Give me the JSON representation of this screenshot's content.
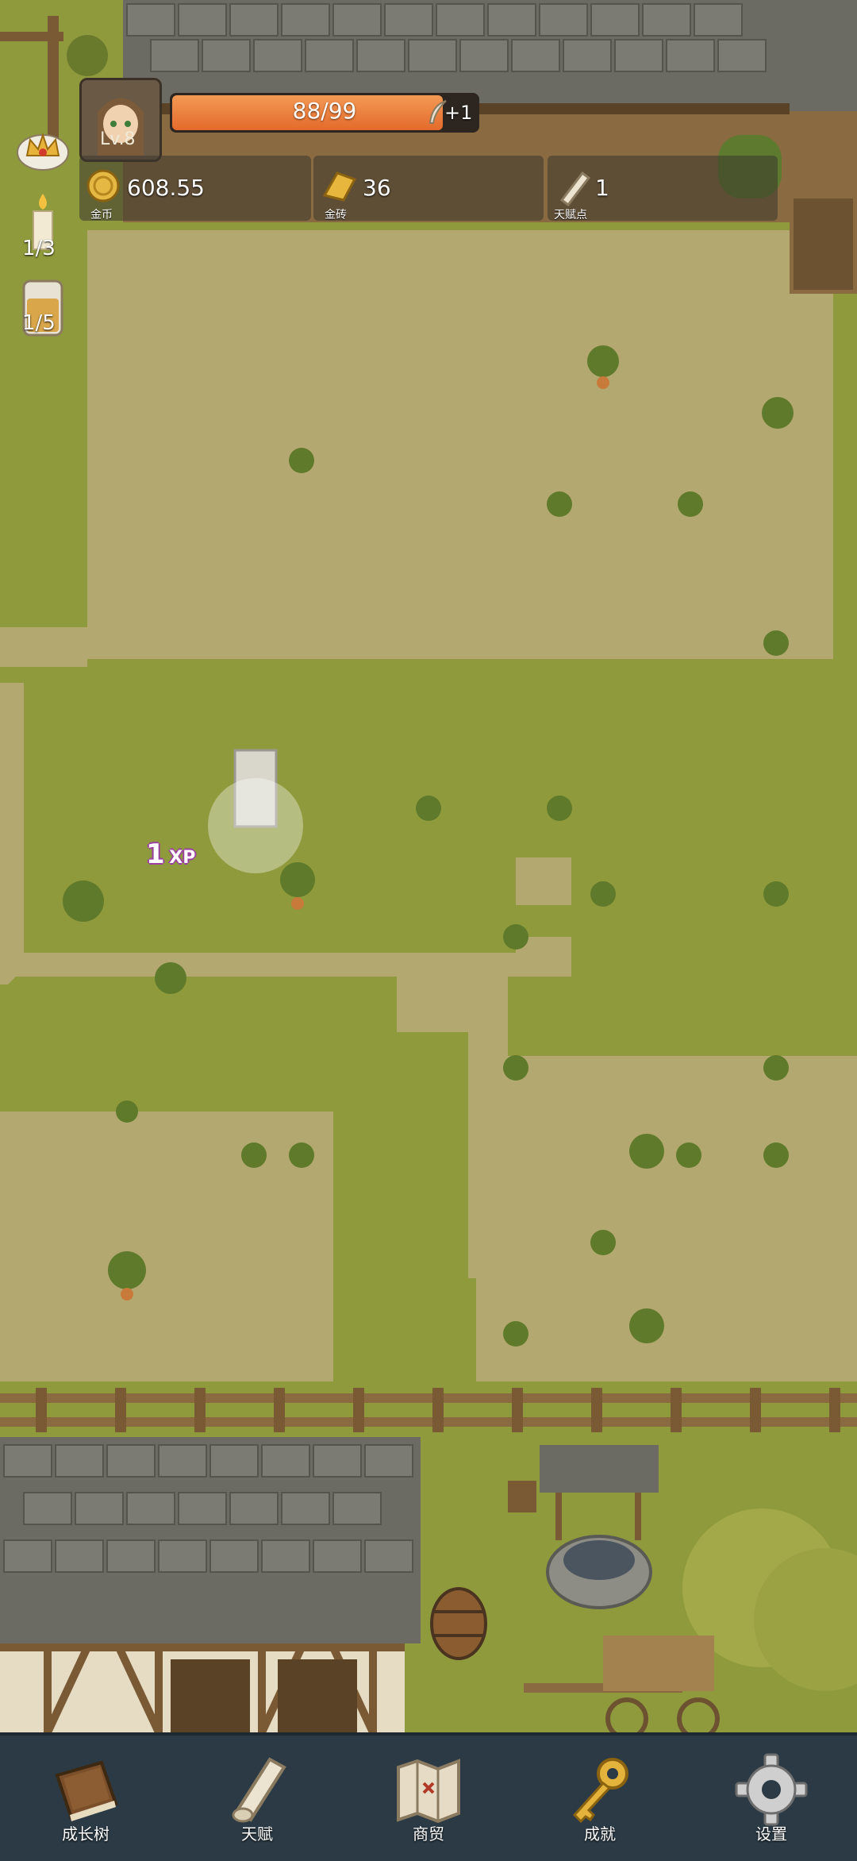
{
  "player": {
    "level": "Lv.8"
  },
  "hp": {
    "text": "88/99",
    "fraction": 0.889,
    "bonus": "+1"
  },
  "resources": [
    {
      "value": "608.55",
      "label": "金币",
      "icon": "gold-coin-icon"
    },
    {
      "value": "36",
      "label": "金砖",
      "icon": "gold-bar-icon"
    },
    {
      "value": "1",
      "label": "天赋点",
      "icon": "scroll-icon"
    }
  ],
  "side": {
    "candle": "1/3",
    "drink": "1/5"
  },
  "floating": {
    "xp_number": "1",
    "xp_unit": "XP"
  },
  "nav": [
    {
      "label": "成长树",
      "icon": "book-icon"
    },
    {
      "label": "天赋",
      "icon": "scroll-icon"
    },
    {
      "label": "商贸",
      "icon": "map-icon"
    },
    {
      "label": "成就",
      "icon": "key-icon"
    },
    {
      "label": "设置",
      "icon": "gear-icon"
    }
  ],
  "colors": {
    "grass": "#8f9a3c",
    "dirt": "#b3a870",
    "nav_bg": "#2b3a45",
    "hp_fill": "#e8733a"
  }
}
